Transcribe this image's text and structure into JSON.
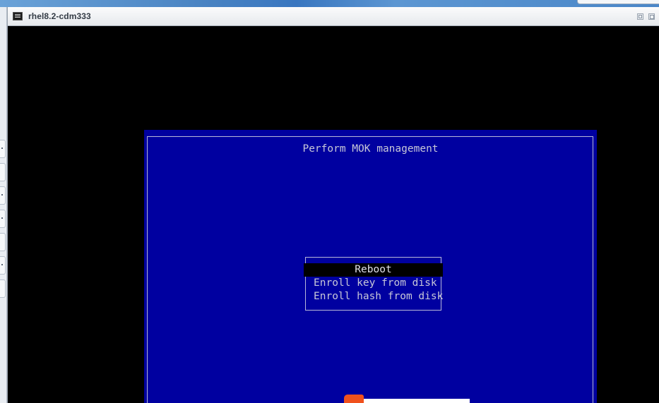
{
  "window": {
    "title": "rhel8.2-cdm333"
  },
  "mok": {
    "title": "Perform MOK management",
    "menu": [
      "Reboot",
      "Enroll key from disk",
      "Enroll hash from disk"
    ],
    "selected_index": 0
  },
  "colors": {
    "mok_background": "#0000a0",
    "console_background": "#000000",
    "text": "#c8c8d8",
    "selection_background": "#000000"
  },
  "icons": {
    "console": "console-icon",
    "restore": "restore-window-icon",
    "maximize": "maximize-window-icon"
  }
}
